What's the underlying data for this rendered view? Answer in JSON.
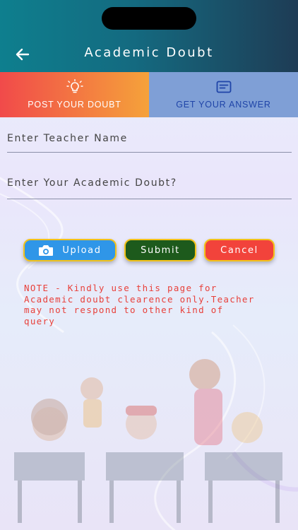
{
  "header": {
    "title": "Academic Doubt",
    "back_icon": "arrow-left-icon"
  },
  "tabs": [
    {
      "label": "POST YOUR DOUBT",
      "icon": "lightbulb-icon",
      "active": true
    },
    {
      "label": "GET YOUR ANSWER",
      "icon": "message-icon",
      "active": false
    }
  ],
  "form": {
    "teacher_placeholder": "Enter Teacher Name",
    "teacher_value": "",
    "doubt_placeholder": "Enter Your Academic Doubt?",
    "doubt_value": ""
  },
  "buttons": {
    "upload_label": "Upload",
    "submit_label": "Submit",
    "cancel_label": "Cancel"
  },
  "note": "NOTE - Kindly use this page for Academic doubt clearence only.Teacher may not respond to other kind of query",
  "colors": {
    "header_start": "#0e7f8e",
    "header_end": "#1e3c55",
    "active_tab_start": "#f14a4a",
    "active_tab_end": "#f5a23a",
    "inactive_tab": "#7f9fd6",
    "upload": "#2f96e8",
    "submit": "#1d5a1c",
    "cancel": "#f2433b",
    "note_text": "#e8403a"
  }
}
